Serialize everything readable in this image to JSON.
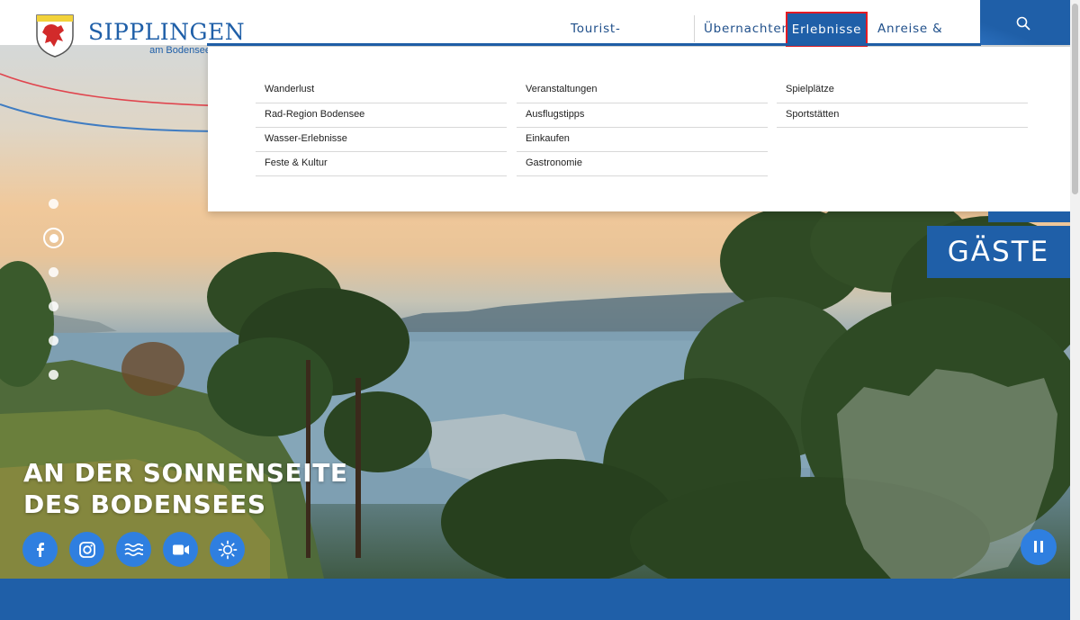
{
  "logo": {
    "name": "SIPPLINGEN",
    "subtitle": "am Bodensee"
  },
  "nav": {
    "items": [
      {
        "label": "Tourist-Information"
      },
      {
        "label": "Übernachten"
      },
      {
        "label": "Erlebnisse",
        "active": true
      },
      {
        "label": "Anreise & Mobil"
      }
    ],
    "search_icon": "search-icon"
  },
  "dropdown": {
    "columns": [
      {
        "items": [
          "Wanderlust",
          "Rad-Region Bodensee",
          "Wasser-Erlebnisse",
          "Feste & Kultur"
        ]
      },
      {
        "items": [
          "Veranstaltungen",
          "Ausflugstipps",
          "Einkaufen",
          "Gastronomie"
        ]
      },
      {
        "items": [
          "Spielplätze",
          "Sportstätten"
        ]
      }
    ]
  },
  "slider": {
    "dot_count": 6,
    "active_index": 1
  },
  "badge": {
    "label": "GÄSTE"
  },
  "headline": {
    "line1": "AN DER SONNENSEITE",
    "line2": "DES BODENSEES"
  },
  "social": [
    {
      "icon": "facebook-icon"
    },
    {
      "icon": "instagram-icon"
    },
    {
      "icon": "waves-icon"
    },
    {
      "icon": "video-camera-icon"
    },
    {
      "icon": "sun-icon"
    }
  ],
  "pause_icon": "pause-icon",
  "colors": {
    "brand_blue": "#1f5fa8",
    "button_blue": "#2f7fe0",
    "highlight_red": "#e41b23"
  }
}
